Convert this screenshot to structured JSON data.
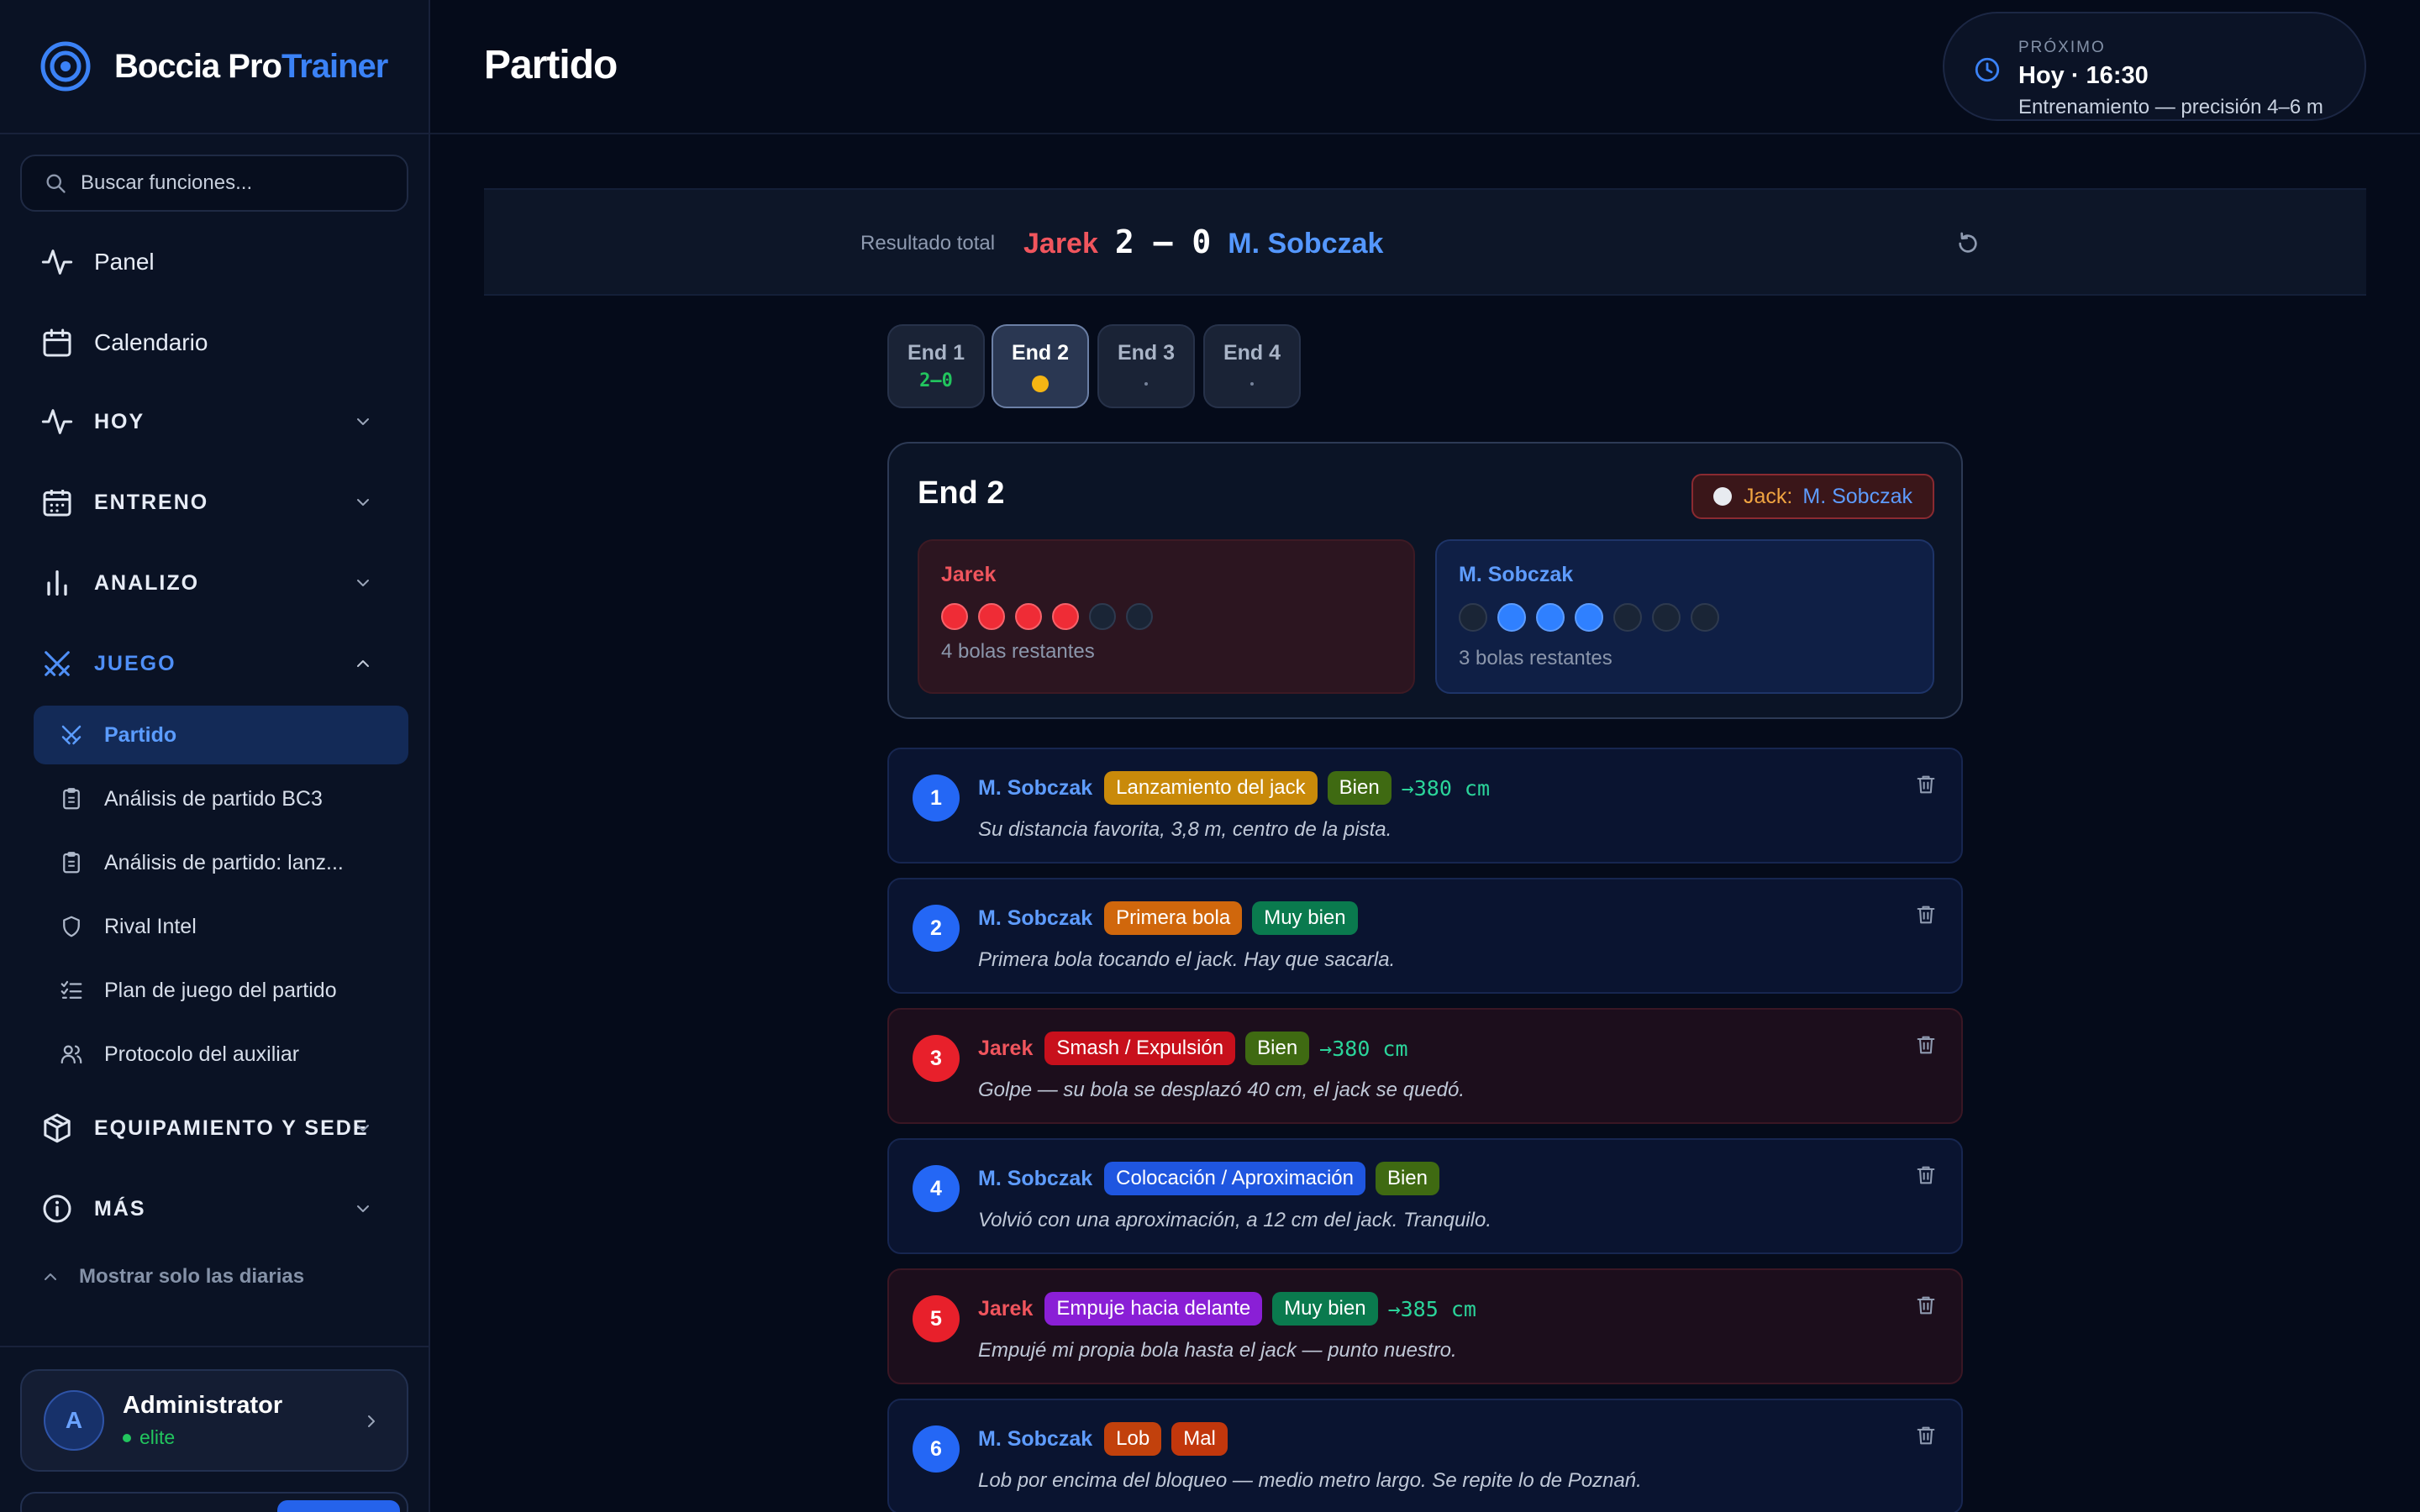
{
  "app": {
    "brand_prefix": "Boccia Pro",
    "brand_accent": "Trainer",
    "accent_color": "#3b82f6"
  },
  "sidebar": {
    "search_placeholder": "Buscar funciones...",
    "items": [
      {
        "label": "Panel",
        "icon": "activity-icon"
      },
      {
        "label": "Calendario",
        "icon": "calendar-icon"
      }
    ],
    "sections": [
      {
        "label": "HOY",
        "icon": "activity-icon",
        "expanded": false
      },
      {
        "label": "ENTRENO",
        "icon": "calendar-grid-icon",
        "expanded": false
      },
      {
        "label": "ANALIZO",
        "icon": "bar-chart-icon",
        "expanded": false
      },
      {
        "label": "JUEGO",
        "icon": "crossed-swords-icon",
        "expanded": true
      },
      {
        "label": "EQUIPAMIENTO Y SEDE",
        "icon": "package-icon",
        "expanded": false
      },
      {
        "label": "MÁS",
        "icon": "info-icon",
        "expanded": false
      }
    ],
    "juego_items": [
      {
        "label": "Partido",
        "icon": "crossed-swords-icon",
        "selected": true
      },
      {
        "label": "Análisis de partido BC3",
        "icon": "clipboard-icon"
      },
      {
        "label": "Análisis de partido: lanz...",
        "icon": "clipboard-icon"
      },
      {
        "label": "Rival Intel",
        "icon": "shield-icon"
      },
      {
        "label": "Plan de juego del partido",
        "icon": "checklist-icon"
      },
      {
        "label": "Protocolo del auxiliar",
        "icon": "users-icon"
      }
    ],
    "collapse_label": "Mostrar solo las diarias",
    "user": {
      "initial": "A",
      "name": "Administrator",
      "level": "elite"
    }
  },
  "header": {
    "title": "Partido",
    "next": {
      "eyebrow": "PRÓXIMO",
      "title": "Hoy · 16:30",
      "description": "Entrenamiento — precisión 4–6 m"
    }
  },
  "score": {
    "label": "Resultado total",
    "player1": "Jarek",
    "player2": "M. Sobczak",
    "score_text": "2 – 0",
    "player1_color": "#f0555d",
    "player2_color": "#5497ff"
  },
  "ends": [
    {
      "label": "End 1",
      "status": "2–0",
      "state": "done"
    },
    {
      "label": "End 2",
      "status": "",
      "state": "current"
    },
    {
      "label": "End 3",
      "status": "·",
      "state": "pending"
    },
    {
      "label": "End 4",
      "status": "·",
      "state": "pending"
    }
  ],
  "current_end": {
    "title": "End 2",
    "jack_label": "Jack:",
    "jack_holder": "M. Sobczak",
    "red": {
      "name": "Jarek",
      "balls_played": 4,
      "balls_total": 6,
      "remaining_text": "4 bolas restantes"
    },
    "blue": {
      "name": "M. Sobczak",
      "balls_played": 3,
      "balls_total": 7,
      "remaining_text": "3 bolas restantes"
    }
  },
  "events": [
    {
      "n": "1",
      "side": "blue",
      "player": "M. Sobczak",
      "tags": [
        {
          "text": "Lanzamiento del jack",
          "color": "#c98a0a"
        },
        {
          "text": "Bien",
          "color": "#3f6a12"
        }
      ],
      "distance": "→380 cm",
      "note": "Su distancia favorita, 3,8 m, centro de la pista."
    },
    {
      "n": "2",
      "side": "blue",
      "player": "M. Sobczak",
      "tags": [
        {
          "text": "Primera bola",
          "color": "#d0670c"
        },
        {
          "text": "Muy bien",
          "color": "#0a7a4e"
        }
      ],
      "distance": "",
      "note": "Primera bola tocando el jack. Hay que sacarla."
    },
    {
      "n": "3",
      "side": "red",
      "player": "Jarek",
      "tags": [
        {
          "text": "Smash / Expulsión",
          "color": "#c8101c"
        },
        {
          "text": "Bien",
          "color": "#3f6a12"
        }
      ],
      "distance": "→380 cm",
      "note": "Golpe — su bola se desplazó 40 cm, el jack se quedó."
    },
    {
      "n": "4",
      "side": "blue",
      "player": "M. Sobczak",
      "tags": [
        {
          "text": "Colocación / Aproximación",
          "color": "#1f56e0"
        },
        {
          "text": "Bien",
          "color": "#3f6a12"
        }
      ],
      "distance": "",
      "note": "Volvió con una aproximación, a 12 cm del jack. Tranquilo."
    },
    {
      "n": "5",
      "side": "red",
      "player": "Jarek",
      "tags": [
        {
          "text": "Empuje hacia delante",
          "color": "#8a1fd6"
        },
        {
          "text": "Muy bien",
          "color": "#0a7a4e"
        }
      ],
      "distance": "→385 cm",
      "note": "Empujé mi propia bola hasta el jack — punto nuestro."
    },
    {
      "n": "6",
      "side": "blue",
      "player": "M. Sobczak",
      "tags": [
        {
          "text": "Lob",
          "color": "#c2410c"
        },
        {
          "text": "Mal",
          "color": "#c2370c"
        }
      ],
      "distance": "",
      "note": "Lob por encima del bloqueo — medio metro largo. Se repite lo de Poznań."
    }
  ]
}
